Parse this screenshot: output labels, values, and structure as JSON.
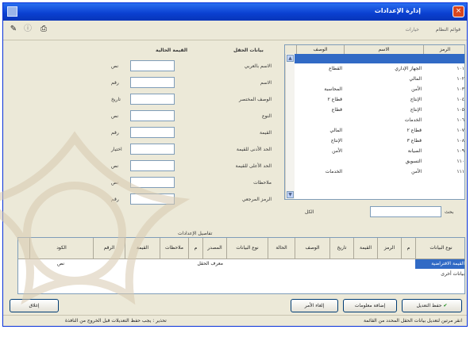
{
  "window": {
    "title": "إدارة الإعدادات",
    "close_label": "×"
  },
  "toolbar": {
    "title_label": "قوائم النظام",
    "options_label": "خيارات",
    "print_icon": "printer-icon",
    "edit_icon": "edit-icon",
    "info_icon": "info-icon"
  },
  "list_grid": {
    "columns": [
      "الرمز",
      "الاسم",
      "الوصف"
    ],
    "rows": [
      {
        "code": "",
        "name": "",
        "desc": "",
        "selected": true
      },
      {
        "code": "١٠١",
        "name": "الجهاز الإداري",
        "desc": "القطاع"
      },
      {
        "code": "١٠٢",
        "name": "المالي",
        "desc": ""
      },
      {
        "code": "١٠٣",
        "name": "الأمن",
        "desc": "المحاسبة"
      },
      {
        "code": "١٠٤",
        "name": "الإنتاج",
        "desc": "قطاع ٢"
      },
      {
        "code": "١٠٥",
        "name": "الإنتاج",
        "desc": "قطاع"
      },
      {
        "code": "١٠٦",
        "name": "الخدمات",
        "desc": ""
      },
      {
        "code": "١٠٧",
        "name": "قطاع ٢",
        "desc": "المالي"
      },
      {
        "code": "١٠٨",
        "name": "قطاع ٣",
        "desc": "الإنتاج"
      },
      {
        "code": "١٠٩",
        "name": "الصيانة",
        "desc": "الأمن"
      },
      {
        "code": "١١٠",
        "name": "التسويق",
        "desc": ""
      },
      {
        "code": "١١١",
        "name": "الأمن",
        "desc": "الخدمات"
      }
    ],
    "search_label": "بحث",
    "filter_label": "الكل"
  },
  "form": {
    "header_field": "بيانات الحقل",
    "header_value": "القيمة الحالية",
    "fields": [
      {
        "label": "الاسم بالعربي",
        "type": "نص"
      },
      {
        "label": "الاسم",
        "type": "رقم"
      },
      {
        "label": "الوصف المختصر",
        "type": "تاريخ"
      },
      {
        "label": "النوع",
        "type": "نص"
      },
      {
        "label": "القيمة",
        "type": "رقم"
      },
      {
        "label": "الحد الأدنى للقيمة",
        "type": "اختيار"
      },
      {
        "label": "الحد الأعلى للقيمة",
        "type": "نص"
      },
      {
        "label": "ملاحظات",
        "type": "نص"
      },
      {
        "label": "الرمز المرجعي",
        "type": "رقم"
      }
    ]
  },
  "bottom_grid": {
    "caption": "تفاصيل الإعدادات",
    "columns": [
      "نوع البيانات",
      "م",
      "الرمز",
      "القيمة",
      "تاريخ",
      "الوصف",
      "الحالة",
      "نوع البيانات",
      "المصدر",
      "م",
      "ملاحظات",
      "القيمة",
      "الرقم",
      "الكود"
    ],
    "rows": [
      {
        "first": "القيمة الافتراضية",
        "mid": "معرف الحقل",
        "last": "نص",
        "selected": true
      },
      {
        "first": "بيانات أخرى",
        "mid": "",
        "last": "",
        "selected": false
      },
      {
        "first": "",
        "mid": "",
        "last": "",
        "selected": false
      }
    ]
  },
  "buttons": {
    "save": "حفظ التعديل",
    "new": "إضافة معلومات",
    "cancel": "إلغاء الأمر",
    "close": "إغلاق"
  },
  "status": {
    "left": "تحذير : يجب حفظ التعديلات قبل الخروج من النافذة",
    "right": "انقر مرتين لتعديل بيانات الحقل المحدد من القائمة"
  },
  "colors": {
    "title_bar": "#0a3fd0",
    "selection": "#316ac5",
    "window_bg": "#ece9d8"
  }
}
